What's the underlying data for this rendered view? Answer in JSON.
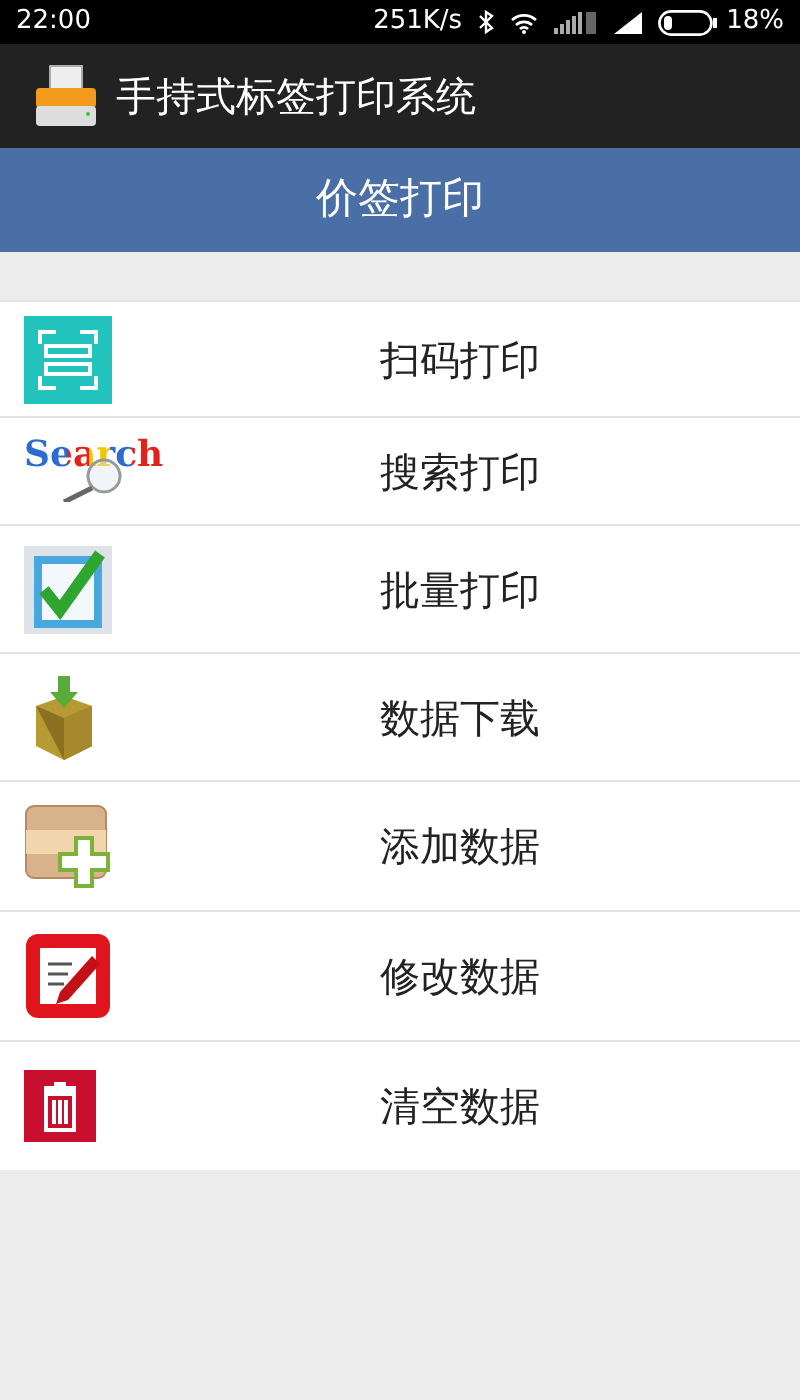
{
  "status_bar": {
    "time": "22:00",
    "speed": "251K/s",
    "battery": "18%"
  },
  "app_bar": {
    "title": "手持式标签打印系统"
  },
  "header": {
    "title": "价签打印"
  },
  "menu": [
    {
      "kind": "scan",
      "label": "扫码打印"
    },
    {
      "kind": "search",
      "label": "搜索打印",
      "icon_text": "Search"
    },
    {
      "kind": "batch",
      "label": "批量打印"
    },
    {
      "kind": "download",
      "label": "数据下载"
    },
    {
      "kind": "add",
      "label": "添加数据"
    },
    {
      "kind": "edit",
      "label": "修改数据"
    },
    {
      "kind": "delete",
      "label": "清空数据"
    }
  ]
}
